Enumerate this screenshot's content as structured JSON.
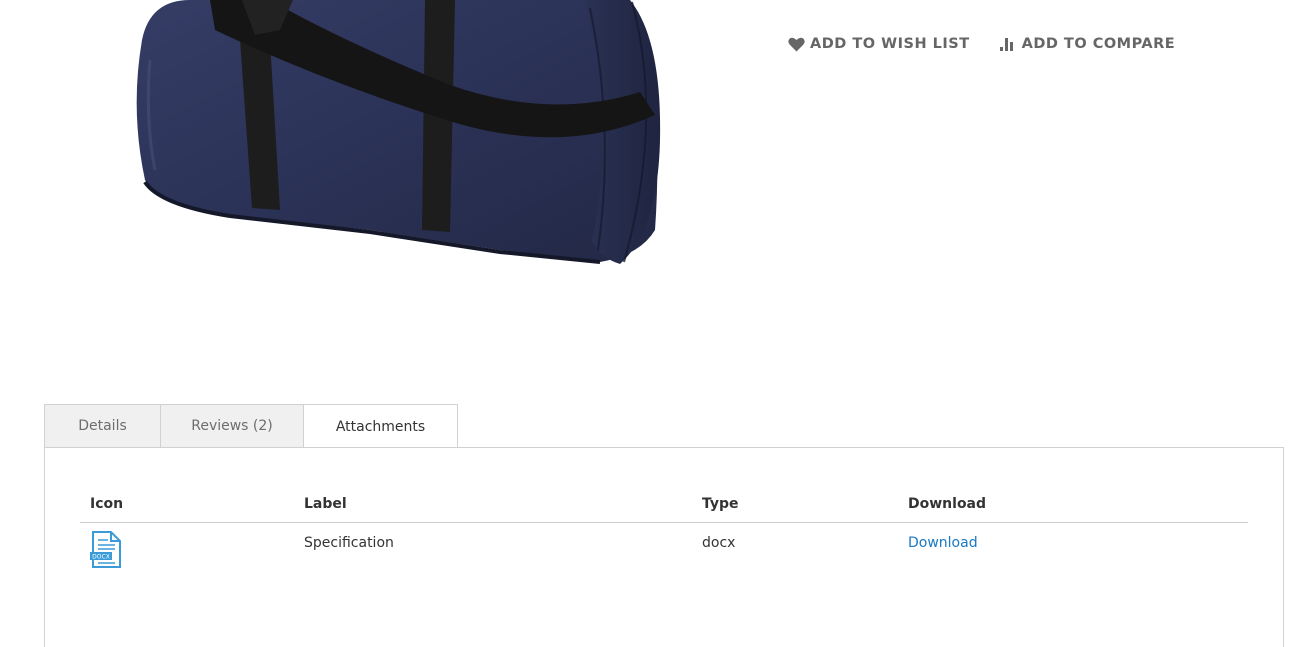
{
  "product": {
    "image_alt": "Navy duffle bag"
  },
  "social_links": {
    "wish_list": {
      "label": "ADD TO WISH LIST",
      "icon": "heart-icon"
    },
    "compare": {
      "label": "ADD TO COMPARE",
      "icon": "compare-bars-icon"
    }
  },
  "tabs": [
    {
      "label": "Details",
      "active": false
    },
    {
      "label": "Reviews (2)",
      "active": false
    },
    {
      "label": "Attachments",
      "active": true
    }
  ],
  "attachments": {
    "headers": {
      "icon": "Icon",
      "label": "Label",
      "type": "Type",
      "download": "Download"
    },
    "rows": [
      {
        "icon": "docx-file-icon",
        "icon_text": "DOCX",
        "label": "Specification",
        "type": "docx",
        "download": "Download"
      }
    ]
  },
  "colors": {
    "link": "#1979c3",
    "bag": "#2a3154",
    "straps": "#1c1c1c"
  }
}
